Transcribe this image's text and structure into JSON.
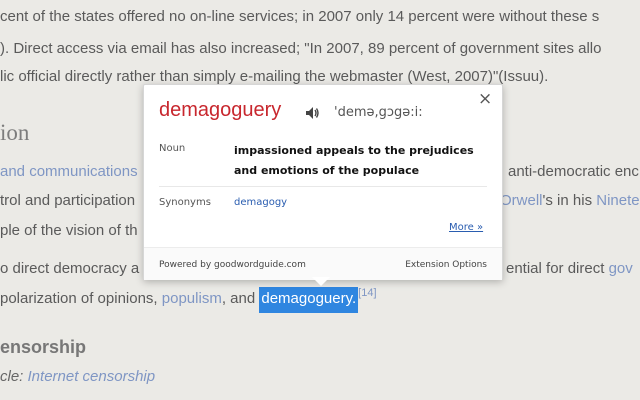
{
  "article": {
    "line1": "cent of the states offered no on-line services; in 2007 only 14 percent were without these s",
    "line2": "). Direct access via email has also increased; \"In 2007, 89 percent of government sites allo",
    "line3": "lic official directly rather than simply e-mailing the webmaster (West, 2007)\"(Issuu).",
    "heading": "ion",
    "line4_link": "and communications",
    "line4_right": "anti-democratic enc",
    "line5_text": "trol and participation",
    "line5_link1": "Orwell",
    "line5_mid": "'s in his",
    "line5_link2": "Ninete",
    "line6_text": "ple of the vision of th",
    "line7_left": "o direct democracy a",
    "line7_right": "ential for direct",
    "line7_link": "gov",
    "line8_pre": "polarization of opinions,",
    "line8_link": "populism",
    "line8_and": ", and",
    "line8_highlight": "demagoguery.",
    "line8_sup": "[14]",
    "subheading": "ensorship",
    "main_article_prefix": "cle:",
    "main_article_link": "Internet censorship"
  },
  "popup": {
    "word": "demagoguery",
    "phonetic": "'demə,gɔgə:i:",
    "speaker_icon": "speaker-icon",
    "close_label": "×",
    "part_of_speech": "Noun",
    "definition": "impassioned appeals to the prejudices and emotions of the populace",
    "synonyms_label": "Synonyms",
    "synonyms": "demagogy",
    "more_label": "More »",
    "powered_by": "Powered by goodwordguide.com",
    "options_label": "Extension Options"
  },
  "colors": {
    "word": "#c8272e",
    "link": "#2a5db0",
    "highlight": "#2f86e0"
  }
}
